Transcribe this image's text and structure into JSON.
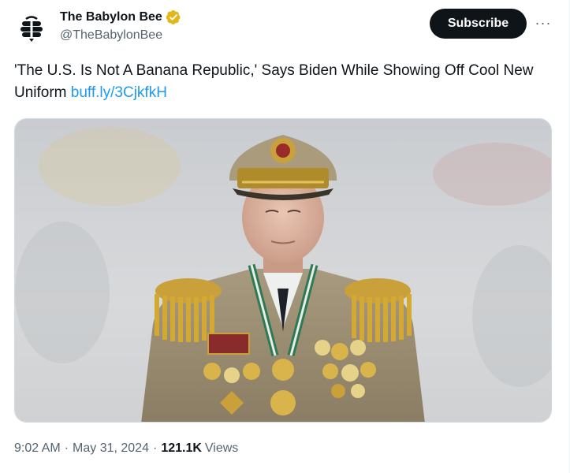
{
  "author": {
    "display_name": "The Babylon Bee",
    "handle": "@TheBabylonBee",
    "avatar_icon": "babylon-bee-logo-icon",
    "verified_icon": "verified-gold-badge-icon",
    "verified_color": "#e2b719"
  },
  "actions": {
    "subscribe_label": "Subscribe",
    "more_label": "···"
  },
  "tweet": {
    "text": "'The U.S. Is Not A Banana Republic,' Says Biden While Showing Off Cool New Uniform ",
    "link_text": "buff.ly/3CjkfkH",
    "link_color": "#1d9bf0"
  },
  "media": {
    "type": "photo",
    "subject": "man in ornate military dress uniform with gold epaulettes, medals and peaked cap"
  },
  "meta": {
    "time": "9:02 AM",
    "separator": "·",
    "date": "May 31, 2024",
    "views_count": "121.1K",
    "views_label": "Views"
  },
  "colors": {
    "text_primary": "#0f1419",
    "text_secondary": "#536471",
    "button_bg": "#0f1419"
  }
}
